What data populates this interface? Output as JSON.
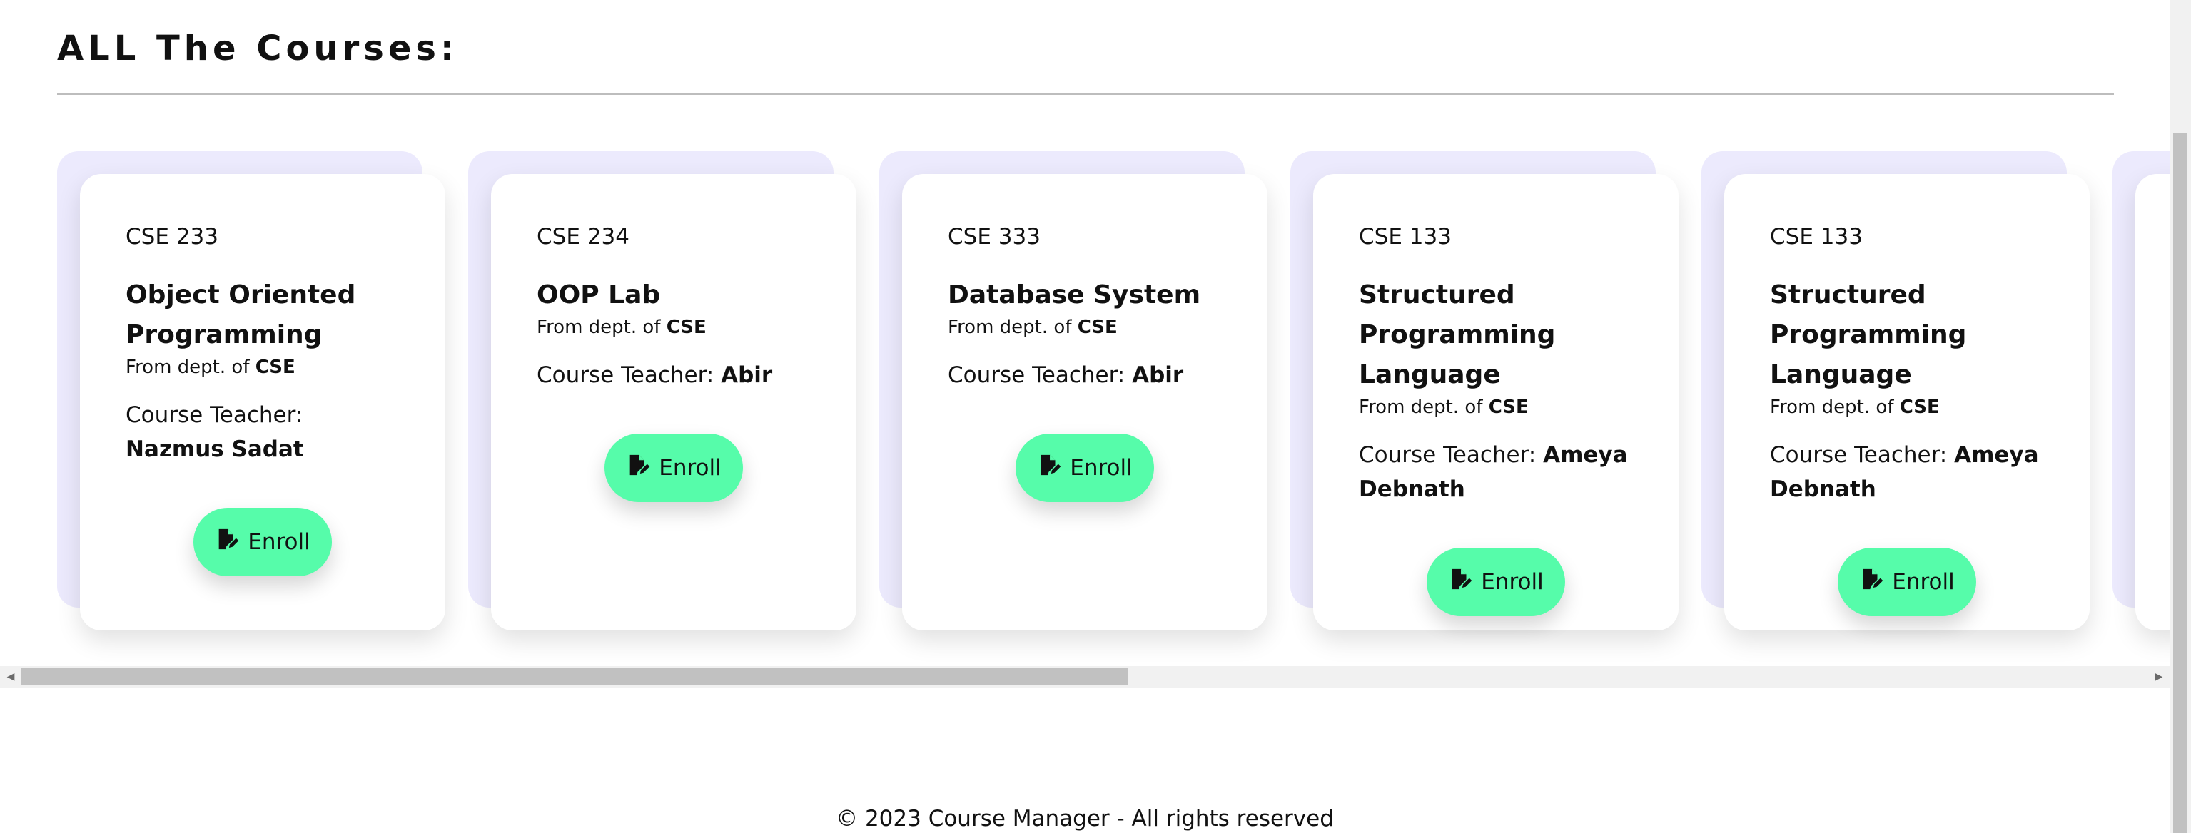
{
  "heading": "ALL The Courses:",
  "courses": [
    {
      "code": "CSE 233",
      "title": "Object Oriented Programming",
      "dept_prefix": "From dept. of",
      "dept": "CSE",
      "teacher_prefix": "Course Teacher:",
      "teacher": "Nazmus Sadat",
      "button": "Enroll"
    },
    {
      "code": "CSE 234",
      "title": "OOP Lab",
      "dept_prefix": "From dept. of",
      "dept": "CSE",
      "teacher_prefix": "Course Teacher:",
      "teacher": "Abir",
      "button": "Enroll"
    },
    {
      "code": "CSE 333",
      "title": "Database System",
      "dept_prefix": "From dept. of",
      "dept": "CSE",
      "teacher_prefix": "Course Teacher:",
      "teacher": "Abir",
      "button": "Enroll"
    },
    {
      "code": "CSE 133",
      "title": "Structured Programming Language",
      "dept_prefix": "From dept. of",
      "dept": "CSE",
      "teacher_prefix": "Course Teacher:",
      "teacher": "Ameya Debnath",
      "button": "Enroll"
    },
    {
      "code": "CSE 133",
      "title": "Structured Programming Language",
      "dept_prefix": "From dept. of",
      "dept": "CSE",
      "teacher_prefix": "Course Teacher:",
      "teacher": "Ameya Debnath",
      "button": "Enroll"
    }
  ],
  "icons": {
    "enroll": "file-edit-icon",
    "scroll_left": "arrow-left-icon",
    "scroll_right": "arrow-right-icon"
  },
  "colors": {
    "enroll_button": "#56fcaa",
    "card_back": "#eceafd",
    "divider": "#bdbdbd"
  },
  "scroll": {
    "horizontal_visible_fraction": 0.52
  },
  "footer": "© 2023 Course Manager - All rights reserved"
}
